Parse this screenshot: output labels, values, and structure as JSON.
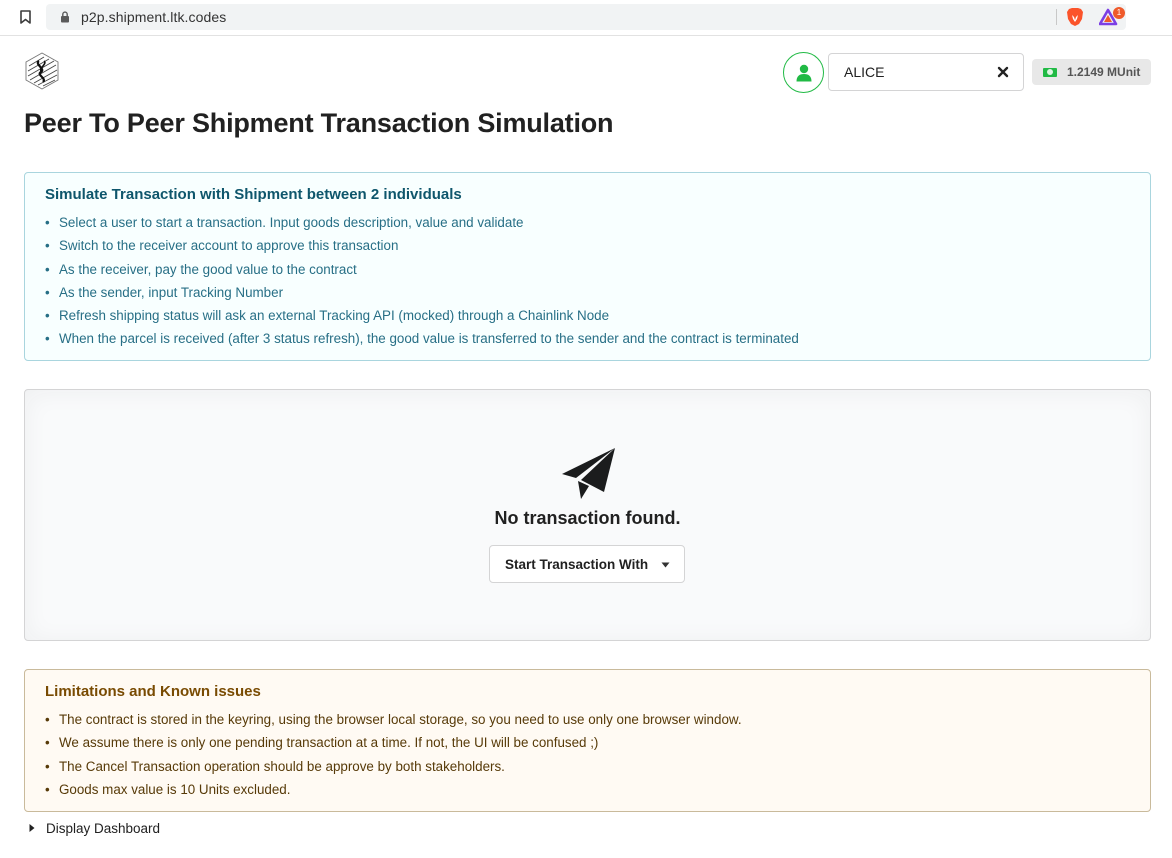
{
  "browser": {
    "url": "p2p.shipment.ltk.codes",
    "rewards_badge": "1"
  },
  "header": {
    "selected_user": "ALICE",
    "balance": "1.2149 MUnit"
  },
  "page": {
    "title": "Peer To Peer Shipment Transaction Simulation"
  },
  "info": {
    "header": "Simulate Transaction with Shipment between 2 individuals",
    "items": [
      "Select a user to start a transaction. Input goods description, value and validate",
      "Switch to the receiver account to approve this transaction",
      "As the receiver, pay the good value to the contract",
      "As the sender, input Tracking Number",
      "Refresh shipping status will ask an external Tracking API (mocked) through a Chainlink Node",
      "When the parcel is received (after 3 status refresh), the good value is transferred to the sender and the contract is terminated"
    ]
  },
  "placeholder": {
    "message": "No transaction found.",
    "button_label": "Start Transaction With"
  },
  "limitations": {
    "header": "Limitations and Known issues",
    "items": [
      "The contract is stored in the keyring, using the browser local storage, so you need to use only one browser window.",
      "We assume there is only one pending transaction at a time. If not, the UI will be confused ;)",
      "The Cancel Transaction operation should be approve by both stakeholders.",
      "Goods max value is 10 Units excluded."
    ]
  },
  "dashboard": {
    "label": "Display Dashboard"
  },
  "colors": {
    "info_bg": "#f8ffff",
    "info_text": "#276f86",
    "warning_bg": "#fffaf3",
    "warning_text": "#573a08",
    "user_accent": "#21ba45"
  },
  "icons": {
    "bookmark": "bookmark-icon",
    "lock": "lock-icon",
    "brave": "brave-lion-icon",
    "rewards": "brave-rewards-icon",
    "avatar": "user-icon",
    "clear": "close-icon",
    "money": "money-bill-icon",
    "empty_state": "paper-plane-icon",
    "dropdown": "caret-down-icon",
    "accordion": "caret-right-icon"
  }
}
